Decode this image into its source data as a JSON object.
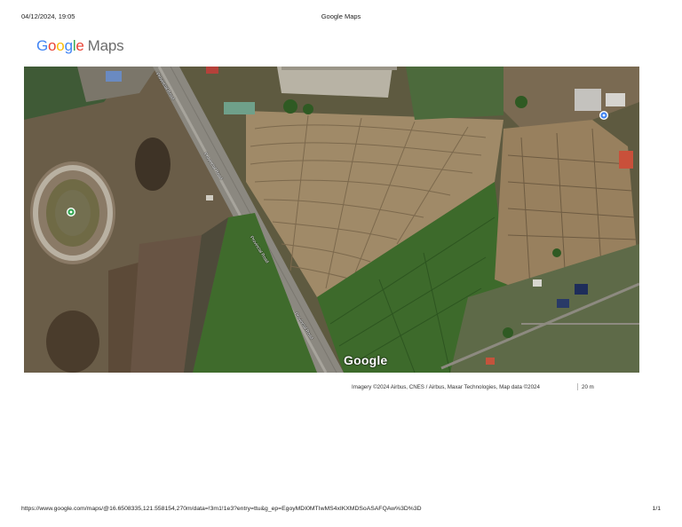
{
  "header": {
    "date_time": "04/12/2024, 19:05",
    "title": "Google Maps"
  },
  "logo": {
    "letters": [
      "G",
      "o",
      "o",
      "g",
      "l",
      "e"
    ],
    "product": "Maps"
  },
  "map": {
    "view": "satellite",
    "watermark": "Google",
    "road_labels": [
      "Provincial Road",
      "Provincial Road",
      "Provincial Road",
      "Provincial Road"
    ],
    "markers": [
      {
        "icon": "place-pin-icon",
        "color": "#34A853"
      },
      {
        "icon": "place-pin-icon",
        "color": "#4285F4"
      }
    ]
  },
  "attribution": "Imagery ©2024 Airbus, CNES / Airbus, Maxar Technologies, Map data ©2024",
  "scale_label": "20 m",
  "footer": {
    "url": "https://www.google.com/maps/@16.6508335,121.558154,270m/data=!3m1!1e3?entry=ttu&g_ep=EgoyMDI0MTIwMS4xIKXMDSoASAFQAw%3D%3D",
    "page": "1/1"
  }
}
